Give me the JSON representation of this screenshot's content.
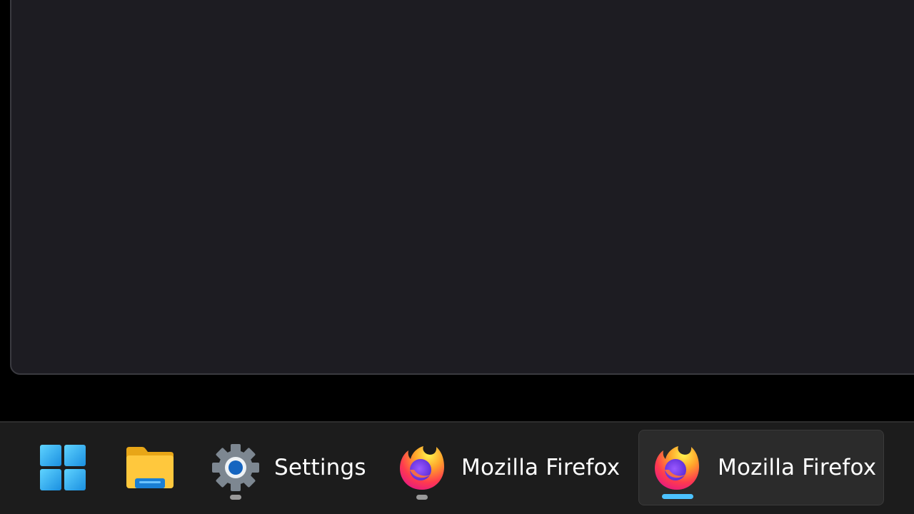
{
  "taskbar": {
    "items": [
      {
        "id": "start",
        "icon": "windows-logo-icon",
        "label": ""
      },
      {
        "id": "file-explorer",
        "icon": "folder-icon",
        "label": ""
      },
      {
        "id": "settings",
        "icon": "gear-icon",
        "label": "Settings",
        "running": true
      },
      {
        "id": "firefox-1",
        "icon": "firefox-icon",
        "label": "Mozilla Firefox",
        "running": true
      },
      {
        "id": "firefox-2",
        "icon": "firefox-icon",
        "label": "Mozilla Firefox",
        "running": true,
        "active": true
      }
    ]
  },
  "colors": {
    "window_bg": "#1d1c22",
    "taskbar_bg": "#1c1c1c",
    "active_indicator": "#4cc2ff",
    "inactive_indicator": "#9a9a9a"
  }
}
